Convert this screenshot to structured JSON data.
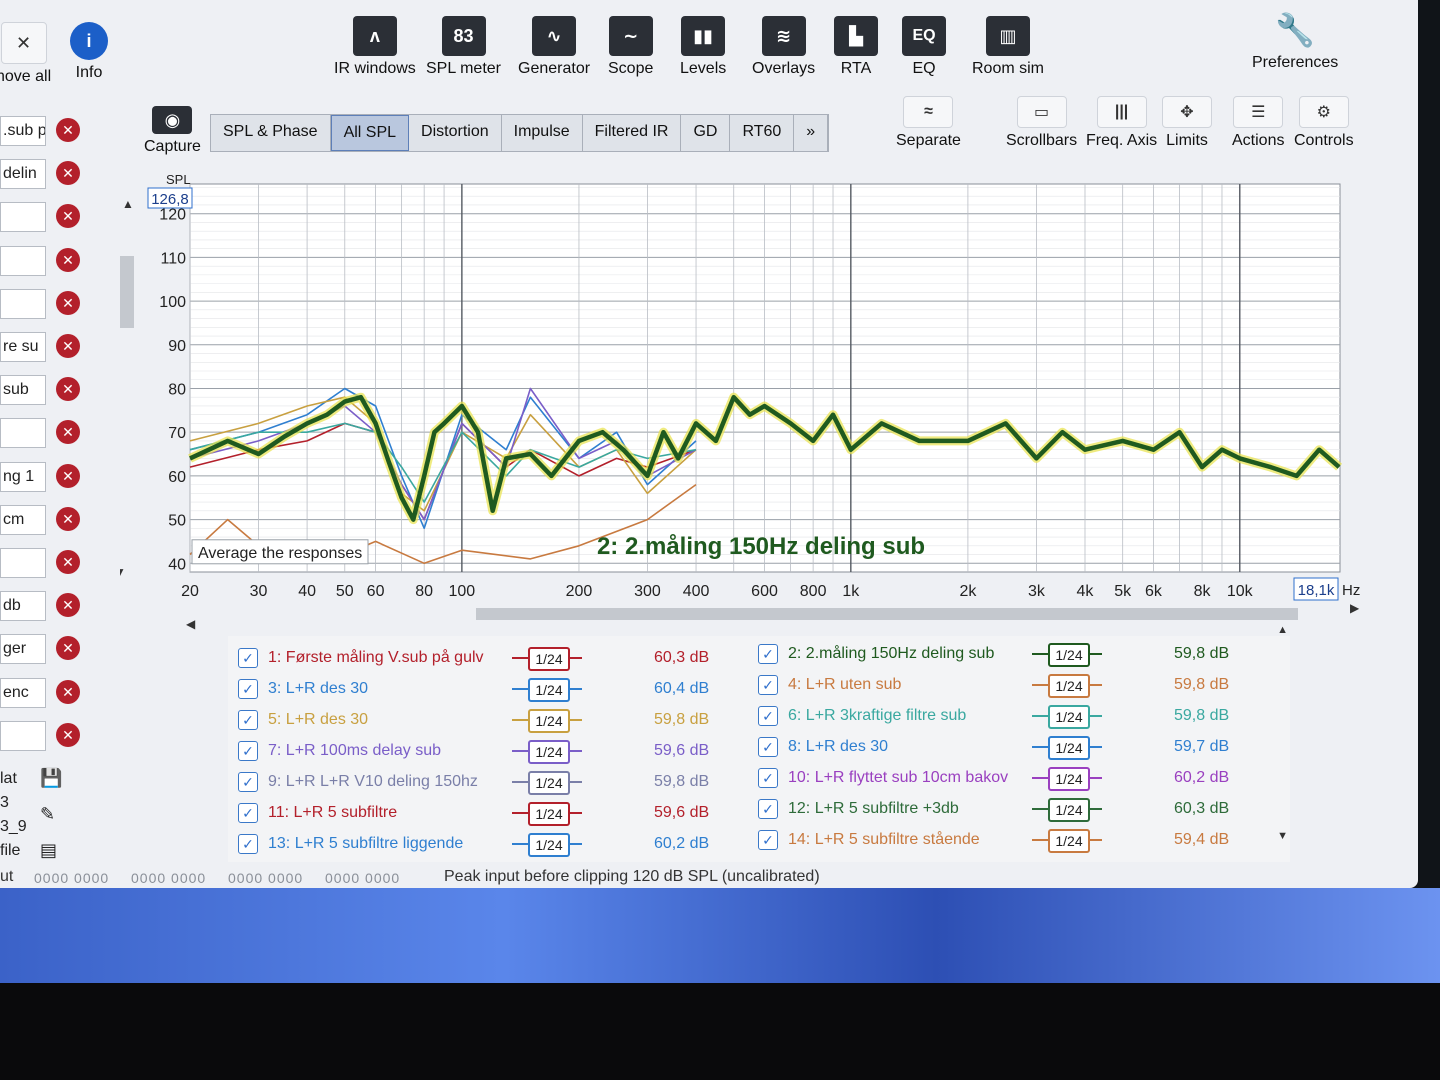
{
  "toolbar": {
    "left": [
      {
        "name": "remove-all-button",
        "label": "nove all",
        "icon": "remove-all-icon"
      },
      {
        "name": "info-button",
        "label": "Info",
        "icon": "info-icon"
      }
    ],
    "top": [
      {
        "name": "ir-windows-button",
        "label": "IR windows",
        "icon": "ir-windows-icon",
        "glyph": "ᴧ"
      },
      {
        "name": "spl-meter-button",
        "label": "SPL meter",
        "icon": "spl-meter-icon",
        "glyph": "83"
      },
      {
        "name": "generator-button",
        "label": "Generator",
        "icon": "generator-icon",
        "glyph": "∿"
      },
      {
        "name": "scope-button",
        "label": "Scope",
        "icon": "scope-icon",
        "glyph": "∼"
      },
      {
        "name": "levels-button",
        "label": "Levels",
        "icon": "levels-icon",
        "glyph": "▮▮"
      },
      {
        "name": "overlays-button",
        "label": "Overlays",
        "icon": "overlays-icon",
        "glyph": "≋"
      },
      {
        "name": "rta-button",
        "label": "RTA",
        "icon": "rta-icon",
        "glyph": "▙"
      },
      {
        "name": "eq-button",
        "label": "EQ",
        "icon": "eq-icon",
        "glyph": "EQ"
      },
      {
        "name": "room-sim-button",
        "label": "Room sim",
        "icon": "room-sim-icon",
        "glyph": "▥"
      }
    ],
    "preferences": "Preferences",
    "capture": "Capture",
    "right": [
      {
        "name": "separate-button",
        "label": "Separate",
        "icon": "separate-icon",
        "glyph": "≈"
      },
      {
        "name": "scrollbars-button",
        "label": "Scrollbars",
        "icon": "scrollbars-icon",
        "glyph": "▭"
      },
      {
        "name": "freq-axis-button",
        "label": "Freq. Axis",
        "icon": "freq-axis-icon",
        "glyph": "|||"
      },
      {
        "name": "limits-button",
        "label": "Limits",
        "icon": "limits-icon",
        "glyph": "✥"
      },
      {
        "name": "actions-button",
        "label": "Actions",
        "icon": "actions-icon",
        "glyph": "☰"
      },
      {
        "name": "controls-button",
        "label": "Controls",
        "icon": "controls-icon",
        "glyph": "⚙"
      }
    ]
  },
  "tabs": [
    "SPL & Phase",
    "All SPL",
    "Distortion",
    "Impulse",
    "Filtered IR",
    "GD",
    "RT60",
    "»"
  ],
  "active_tab": 1,
  "left_list": [
    ".sub p",
    "delin",
    "",
    "",
    "",
    "re su",
    "sub",
    "",
    "ng 1",
    "cm",
    "",
    "db",
    "ger",
    "enc",
    ""
  ],
  "left_bottom": [
    "lat",
    "3",
    "3_9",
    "file"
  ],
  "left_bottom_right": [
    "ut"
  ],
  "chart": {
    "y_axis_title": "SPL",
    "y_top_readout": "126,8",
    "y_ticks": [
      "120",
      "110",
      "100",
      "90",
      "80",
      "70",
      "60",
      "50",
      "40"
    ],
    "x_ticks": [
      "20",
      "30",
      "40",
      "50",
      "60",
      "80",
      "100",
      "200",
      "300",
      "400",
      "600",
      "800",
      "1k",
      "2k",
      "3k",
      "4k",
      "5k",
      "6k",
      "8k",
      "10k"
    ],
    "x_end_readout": "18,1k",
    "x_unit": "Hz",
    "overlay_label": "2: 2.måling 150Hz deling sub",
    "tooltip": "Average the responses"
  },
  "chart_data": {
    "type": "line",
    "title": "",
    "xlabel": "",
    "ylabel": "SPL",
    "xscale": "log",
    "xlim": [
      20,
      18100
    ],
    "ylim": [
      38,
      126.8
    ],
    "series": [
      {
        "name": "2: 2.måling 150Hz deling sub",
        "color": "#1f5a1f",
        "x": [
          20,
          25,
          30,
          35,
          40,
          45,
          50,
          55,
          60,
          65,
          70,
          75,
          80,
          85,
          90,
          100,
          110,
          120,
          130,
          150,
          170,
          200,
          230,
          260,
          300,
          330,
          360,
          400,
          450,
          500,
          550,
          600,
          700,
          800,
          900,
          1000,
          1200,
          1500,
          2000,
          2500,
          3000,
          3500,
          4000,
          5000,
          6000,
          7000,
          8000,
          9000,
          10000,
          12000,
          14000,
          16000,
          18000
        ],
        "y": [
          64,
          68,
          65,
          69,
          72,
          74,
          77,
          78,
          72,
          63,
          55,
          50,
          60,
          70,
          72,
          76,
          70,
          52,
          64,
          65,
          60,
          68,
          70,
          66,
          60,
          70,
          64,
          72,
          68,
          78,
          74,
          76,
          72,
          68,
          74,
          66,
          72,
          68,
          68,
          72,
          64,
          70,
          66,
          68,
          66,
          70,
          62,
          66,
          64,
          62,
          60,
          66,
          62
        ]
      },
      {
        "name": "1: Første måling V.sub på gulv",
        "color": "#b3202b",
        "x": [
          20,
          30,
          40,
          50,
          60,
          70,
          80,
          100,
          130,
          150,
          200,
          250,
          300,
          400
        ],
        "y": [
          62,
          66,
          68,
          72,
          70,
          58,
          50,
          72,
          62,
          66,
          60,
          64,
          62,
          66
        ]
      },
      {
        "name": "3: L+R des 30",
        "color": "#2f7fd0",
        "x": [
          20,
          30,
          40,
          50,
          60,
          70,
          80,
          100,
          130,
          150,
          200,
          250,
          300,
          400
        ],
        "y": [
          66,
          70,
          74,
          80,
          76,
          60,
          48,
          74,
          66,
          78,
          64,
          70,
          58,
          68
        ]
      },
      {
        "name": "5: L+R des 30",
        "color": "#c8a040",
        "x": [
          20,
          30,
          40,
          50,
          60,
          70,
          80,
          100,
          130,
          150,
          200,
          250,
          300,
          400
        ],
        "y": [
          68,
          72,
          76,
          78,
          72,
          56,
          52,
          70,
          64,
          74,
          62,
          66,
          56,
          66
        ]
      },
      {
        "name": "7: L+R 100ms delay sub",
        "color": "#7a5ec8",
        "x": [
          20,
          30,
          40,
          50,
          60,
          70,
          80,
          100,
          130,
          150,
          200,
          250,
          300,
          400
        ],
        "y": [
          64,
          68,
          72,
          76,
          70,
          58,
          50,
          72,
          62,
          80,
          64,
          68,
          60,
          66
        ]
      },
      {
        "name": "4: L+R uten sub",
        "color": "#c87a40",
        "x": [
          20,
          25,
          30,
          40,
          50,
          60,
          80,
          100,
          150,
          200,
          300,
          400
        ],
        "y": [
          42,
          50,
          44,
          40,
          42,
          45,
          40,
          43,
          41,
          44,
          50,
          58
        ]
      },
      {
        "name": "6: L+R 3kraftige filtre sub",
        "color": "#3aa8a0",
        "x": [
          20,
          30,
          40,
          50,
          60,
          70,
          80,
          100,
          130,
          150,
          200,
          250,
          300,
          400
        ],
        "y": [
          66,
          70,
          70,
          72,
          70,
          62,
          54,
          70,
          60,
          66,
          62,
          66,
          64,
          66
        ]
      }
    ]
  },
  "legend": [
    {
      "text": "1: Første måling V.sub på gulv",
      "color": "#b3202b",
      "value": "60,3 dB",
      "checked": true
    },
    {
      "text": "2: 2.måling 150Hz deling sub",
      "color": "#1f5a1f",
      "value": "59,8 dB",
      "checked": true
    },
    {
      "text": "3: L+R des 30",
      "color": "#2f7fd0",
      "value": "60,4 dB",
      "checked": true
    },
    {
      "text": "4: L+R uten sub",
      "color": "#c87a40",
      "value": "59,8 dB",
      "checked": true
    },
    {
      "text": "5: L+R des 30",
      "color": "#c8a040",
      "value": "59,8 dB",
      "checked": true
    },
    {
      "text": "6: L+R 3kraftige filtre sub",
      "color": "#3aa8a0",
      "value": "59,8 dB",
      "checked": true
    },
    {
      "text": "7: L+R 100ms delay sub",
      "color": "#7a5ec8",
      "value": "59,6 dB",
      "checked": true
    },
    {
      "text": "8: L+R des 30",
      "color": "#2f7fd0",
      "value": "59,7 dB",
      "checked": true
    },
    {
      "text": "9: L+R L+R V10 deling 150hz",
      "color": "#7a7fa8",
      "value": "59,8 dB",
      "checked": true
    },
    {
      "text": "10: L+R flyttet sub 10cm bakov",
      "color": "#9a40c0",
      "value": "60,2 dB",
      "checked": true
    },
    {
      "text": "11: L+R 5 subfiltre",
      "color": "#b3202b",
      "value": "59,6 dB",
      "checked": true
    },
    {
      "text": "12: L+R 5 subfiltre +3db",
      "color": "#2e6b3a",
      "value": "60,3 dB",
      "checked": true
    },
    {
      "text": "13: L+R 5 subfiltre liggende",
      "color": "#2f7fd0",
      "value": "60,2 dB",
      "checked": true
    },
    {
      "text": "14: L+R 5 subfiltre stående",
      "color": "#c87a40",
      "value": "59,4 dB",
      "checked": true
    }
  ],
  "smoothing_label": "1/24",
  "status": {
    "left_label": "ut",
    "meters": [
      "0000 0000",
      "0000 0000",
      "0000 0000",
      "0000 0000"
    ],
    "message": "Peak input before clipping 120 dB SPL (uncalibrated)"
  }
}
